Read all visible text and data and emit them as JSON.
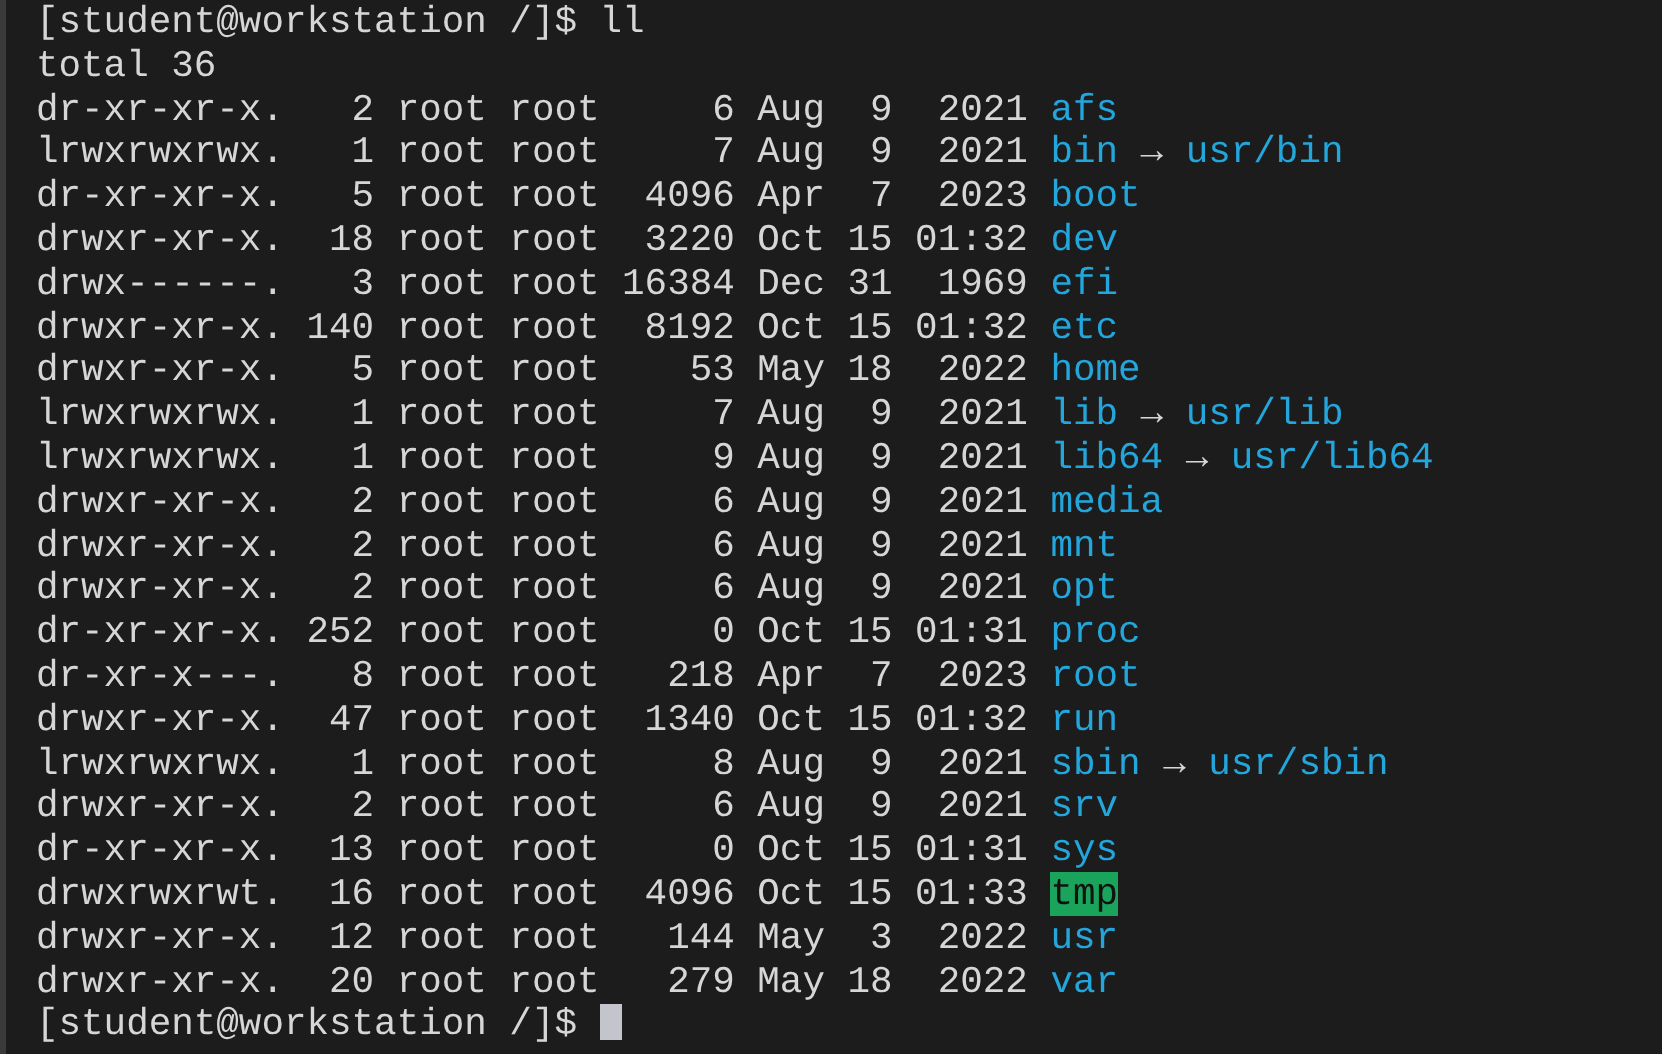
{
  "lines": [
    {
      "kind": "prompt",
      "prompt": "[student@workstation /]$",
      "command": "ll"
    },
    {
      "kind": "text",
      "text": "total 36"
    },
    {
      "kind": "dir",
      "info": "dr-xr-xr-x.   2 root root     6 Aug  9  2021",
      "name": "afs"
    },
    {
      "kind": "link",
      "info": "lrwxrwxrwx.   1 root root     7 Aug  9  2021",
      "name": "bin",
      "arrow": "→",
      "target": "usr/bin"
    },
    {
      "kind": "dir",
      "info": "dr-xr-xr-x.   5 root root  4096 Apr  7  2023",
      "name": "boot"
    },
    {
      "kind": "dir",
      "info": "drwxr-xr-x.  18 root root  3220 Oct 15 01:32",
      "name": "dev"
    },
    {
      "kind": "dir",
      "info": "drwx------.   3 root root 16384 Dec 31  1969",
      "name": "efi"
    },
    {
      "kind": "dir",
      "info": "drwxr-xr-x. 140 root root  8192 Oct 15 01:32",
      "name": "etc"
    },
    {
      "kind": "dir",
      "info": "drwxr-xr-x.   5 root root    53 May 18  2022",
      "name": "home"
    },
    {
      "kind": "link",
      "info": "lrwxrwxrwx.   1 root root     7 Aug  9  2021",
      "name": "lib",
      "arrow": "→",
      "target": "usr/lib"
    },
    {
      "kind": "link",
      "info": "lrwxrwxrwx.   1 root root     9 Aug  9  2021",
      "name": "lib64",
      "arrow": "→",
      "target": "usr/lib64"
    },
    {
      "kind": "dir",
      "info": "drwxr-xr-x.   2 root root     6 Aug  9  2021",
      "name": "media"
    },
    {
      "kind": "dir",
      "info": "drwxr-xr-x.   2 root root     6 Aug  9  2021",
      "name": "mnt"
    },
    {
      "kind": "dir",
      "info": "drwxr-xr-x.   2 root root     6 Aug  9  2021",
      "name": "opt"
    },
    {
      "kind": "dir",
      "info": "dr-xr-xr-x. 252 root root     0 Oct 15 01:31",
      "name": "proc"
    },
    {
      "kind": "dir",
      "info": "dr-xr-x---.   8 root root   218 Apr  7  2023",
      "name": "root"
    },
    {
      "kind": "dir",
      "info": "drwxr-xr-x.  47 root root  1340 Oct 15 01:32",
      "name": "run"
    },
    {
      "kind": "link",
      "info": "lrwxrwxrwx.   1 root root     8 Aug  9  2021",
      "name": "sbin",
      "arrow": "→",
      "target": "usr/sbin"
    },
    {
      "kind": "dir",
      "info": "drwxr-xr-x.   2 root root     6 Aug  9  2021",
      "name": "srv"
    },
    {
      "kind": "dir",
      "info": "dr-xr-xr-x.  13 root root     0 Oct 15 01:31",
      "name": "sys"
    },
    {
      "kind": "sticky",
      "info": "drwxrwxrwt.  16 root root  4096 Oct 15 01:33",
      "name": "tmp"
    },
    {
      "kind": "dir",
      "info": "drwxr-xr-x.  12 root root   144 May  3  2022",
      "name": "usr"
    },
    {
      "kind": "dir",
      "info": "drwxr-xr-x.  20 root root   279 May 18  2022",
      "name": "var"
    },
    {
      "kind": "prompt",
      "prompt": "[student@workstation /]$",
      "cursor": true
    }
  ]
}
